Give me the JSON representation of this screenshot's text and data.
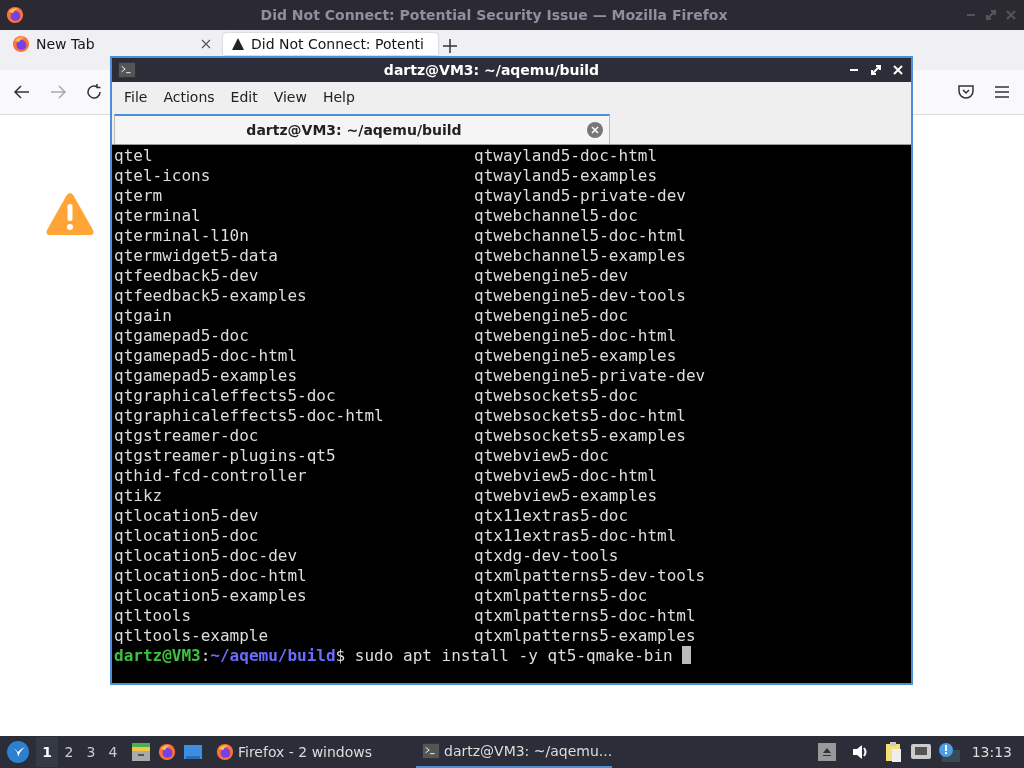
{
  "firefox": {
    "title": "Did Not Connect: Potential Security Issue — Mozilla Firefox",
    "tabs": [
      {
        "label": "New Tab",
        "selected": false,
        "kind": "firefox"
      },
      {
        "label": "Did Not Connect: Potenti",
        "selected": true,
        "kind": "warning"
      }
    ]
  },
  "terminal": {
    "title": "dartz@VM3: ~/aqemu/build",
    "menu": [
      "File",
      "Actions",
      "Edit",
      "View",
      "Help"
    ],
    "tab_label": "dartz@VM3: ~/aqemu/build",
    "lines": [
      [
        "qtel",
        "qtwayland5-doc-html"
      ],
      [
        "qtel-icons",
        "qtwayland5-examples"
      ],
      [
        "qterm",
        "qtwayland5-private-dev"
      ],
      [
        "qterminal",
        "qtwebchannel5-doc"
      ],
      [
        "qterminal-l10n",
        "qtwebchannel5-doc-html"
      ],
      [
        "qtermwidget5-data",
        "qtwebchannel5-examples"
      ],
      [
        "qtfeedback5-dev",
        "qtwebengine5-dev"
      ],
      [
        "qtfeedback5-examples",
        "qtwebengine5-dev-tools"
      ],
      [
        "qtgain",
        "qtwebengine5-doc"
      ],
      [
        "qtgamepad5-doc",
        "qtwebengine5-doc-html"
      ],
      [
        "qtgamepad5-doc-html",
        "qtwebengine5-examples"
      ],
      [
        "qtgamepad5-examples",
        "qtwebengine5-private-dev"
      ],
      [
        "qtgraphicaleffects5-doc",
        "qtwebsockets5-doc"
      ],
      [
        "qtgraphicaleffects5-doc-html",
        "qtwebsockets5-doc-html"
      ],
      [
        "qtgstreamer-doc",
        "qtwebsockets5-examples"
      ],
      [
        "qtgstreamer-plugins-qt5",
        "qtwebview5-doc"
      ],
      [
        "qthid-fcd-controller",
        "qtwebview5-doc-html"
      ],
      [
        "qtikz",
        "qtwebview5-examples"
      ],
      [
        "qtlocation5-dev",
        "qtx11extras5-doc"
      ],
      [
        "qtlocation5-doc",
        "qtx11extras5-doc-html"
      ],
      [
        "qtlocation5-doc-dev",
        "qtxdg-dev-tools"
      ],
      [
        "qtlocation5-doc-html",
        "qtxmlpatterns5-dev-tools"
      ],
      [
        "qtlocation5-examples",
        "qtxmlpatterns5-doc"
      ],
      [
        "qtltools",
        "qtxmlpatterns5-doc-html"
      ],
      [
        "qtltools-example",
        "qtxmlpatterns5-examples"
      ]
    ],
    "prompt": {
      "user_host": "dartz@VM3",
      "separator": ":",
      "path": "~/aqemu/build",
      "symbol": "$",
      "command": " sudo apt install -y qt5-qmake-bin "
    }
  },
  "taskbar": {
    "workspaces": [
      {
        "label": "1",
        "selected": true
      },
      {
        "label": "2",
        "selected": false
      },
      {
        "label": "3",
        "selected": false
      },
      {
        "label": "4",
        "selected": false
      }
    ],
    "tasks": [
      {
        "label": "Firefox - 2 windows",
        "kind": "firefox",
        "selected": false
      },
      {
        "label": "dartz@VM3: ~/aqemu...",
        "kind": "terminal",
        "selected": true
      }
    ],
    "clock": "13:13"
  }
}
